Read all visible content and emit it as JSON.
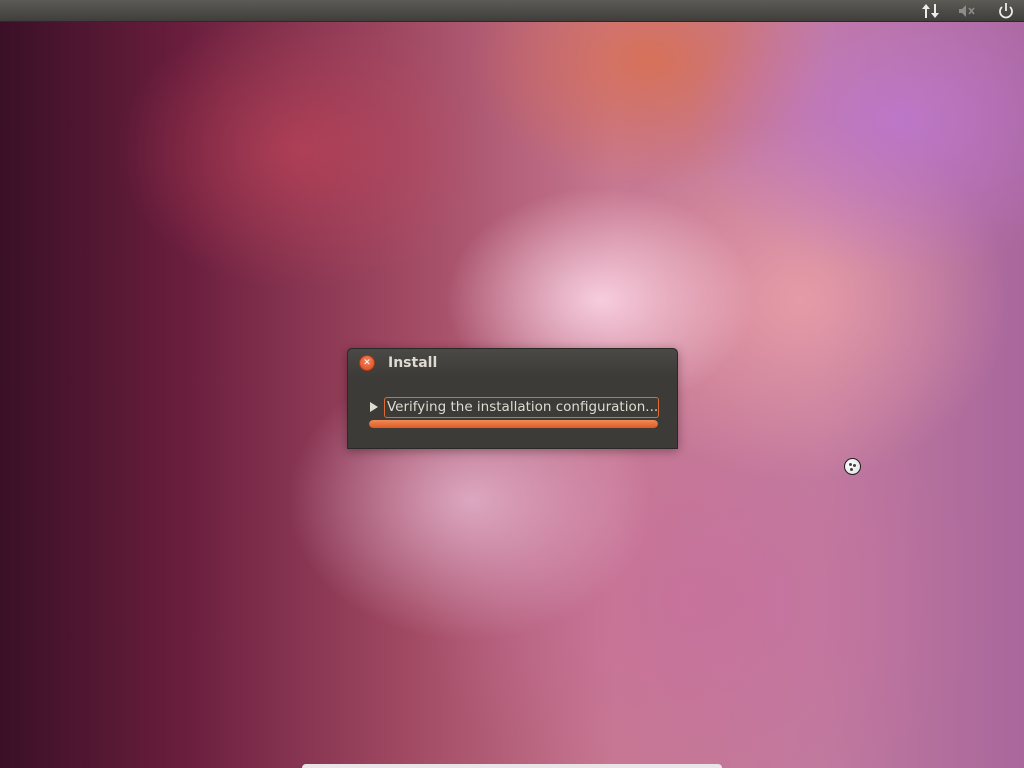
{
  "top_panel": {
    "icons": [
      "network-updown-icon",
      "volume-muted-icon",
      "power-icon"
    ]
  },
  "dialog": {
    "title": "Install",
    "status_text": "Verifying the installation configuration...",
    "progress": 1.0
  },
  "colors": {
    "accent": "#dd5a26",
    "panel": "#3c3b37",
    "dialog_bg": "#3c3b37",
    "text": "#dfdbd2"
  }
}
